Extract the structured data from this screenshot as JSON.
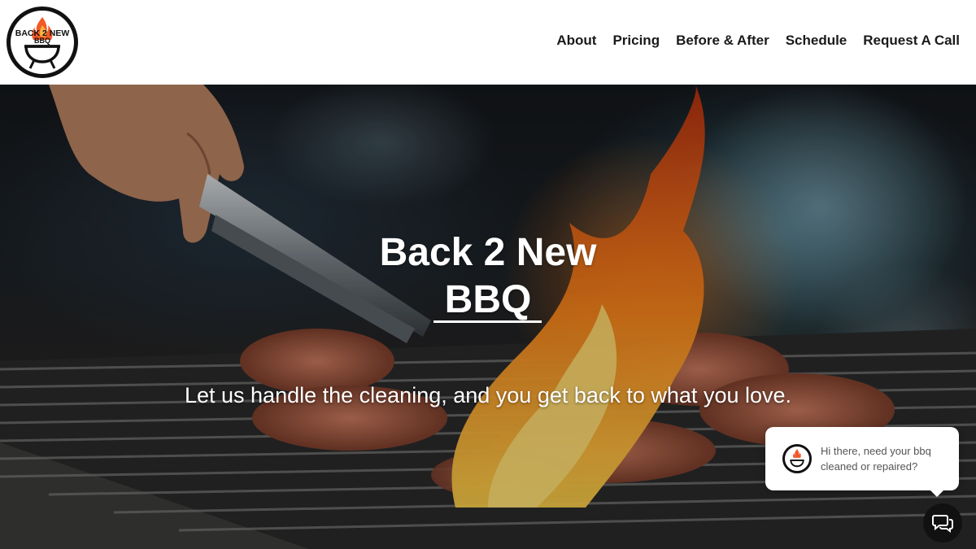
{
  "logo": {
    "line1": "BACK 2 NEW",
    "line2": "BBQ",
    "icon": "grill-flame-logo"
  },
  "nav": {
    "items": [
      {
        "label": "About"
      },
      {
        "label": "Pricing"
      },
      {
        "label": "Before & After"
      },
      {
        "label": "Schedule"
      },
      {
        "label": "Request A Call"
      }
    ]
  },
  "hero": {
    "title_line1": "Back 2 New",
    "title_line2": "BBQ",
    "subtitle": "Let us handle the cleaning, and you get back to what you love.",
    "background": "grilling-meat-flames-photo"
  },
  "chat": {
    "message": "Hi there, need your bbq cleaned or repaired?",
    "avatar_icon": "grill-flame-logo",
    "launcher_icon": "chat-bubbles-icon"
  },
  "colors": {
    "text_dark": "#1a1a1a",
    "white": "#ffffff",
    "flame": "#ff7a1a",
    "launcher": "#111111"
  }
}
